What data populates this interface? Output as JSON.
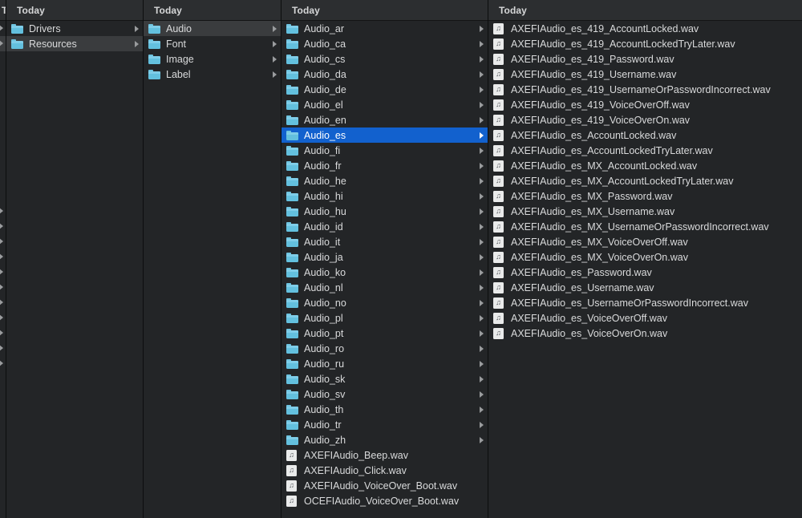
{
  "window": {
    "view_mode": "column",
    "background_color": "#232527",
    "selection_color": "#1261ce",
    "header_label": "Today"
  },
  "columns": [
    {
      "id": "partial-left",
      "header": "Today",
      "truncated": true,
      "stub_rows": [
        {
          "arrow": true,
          "highlighted": false
        },
        {
          "arrow": true,
          "highlighted": true
        },
        {
          "arrow": false,
          "highlighted": false
        },
        {
          "arrow": false,
          "highlighted": false
        },
        {
          "arrow": false,
          "highlighted": false
        },
        {
          "arrow": false,
          "highlighted": false
        },
        {
          "arrow": false,
          "highlighted": false
        },
        {
          "arrow": false,
          "highlighted": false
        },
        {
          "arrow": false,
          "highlighted": false
        },
        {
          "arrow": false,
          "highlighted": false
        },
        {
          "arrow": false,
          "highlighted": false
        },
        {
          "arrow": false,
          "highlighted": false
        },
        {
          "arrow": true,
          "highlighted": false
        },
        {
          "arrow": true,
          "highlighted": false
        },
        {
          "arrow": true,
          "highlighted": false
        },
        {
          "arrow": true,
          "highlighted": false
        },
        {
          "arrow": true,
          "highlighted": false
        },
        {
          "arrow": true,
          "highlighted": false
        },
        {
          "arrow": true,
          "highlighted": false
        },
        {
          "arrow": true,
          "highlighted": false
        },
        {
          "arrow": true,
          "highlighted": false
        },
        {
          "arrow": true,
          "highlighted": false
        },
        {
          "arrow": true,
          "highlighted": false
        }
      ]
    },
    {
      "id": "col-drivers",
      "header": "Today",
      "items": [
        {
          "name": "Drivers",
          "icon": "folder-icon",
          "arrow": true,
          "selected": false,
          "hovered": false
        },
        {
          "name": "Resources",
          "icon": "folder-icon",
          "arrow": true,
          "selected": false,
          "hovered": true
        }
      ]
    },
    {
      "id": "col-resources",
      "header": "Today",
      "items": [
        {
          "name": "Audio",
          "icon": "folder-icon",
          "arrow": true,
          "selected": false,
          "hovered": true
        },
        {
          "name": "Font",
          "icon": "folder-icon",
          "arrow": true,
          "selected": false,
          "hovered": false
        },
        {
          "name": "Image",
          "icon": "folder-icon",
          "arrow": true,
          "selected": false,
          "hovered": false
        },
        {
          "name": "Label",
          "icon": "folder-icon",
          "arrow": true,
          "selected": false,
          "hovered": false
        }
      ]
    },
    {
      "id": "col-audio",
      "header": "Today",
      "items": [
        {
          "name": "Audio_ar",
          "icon": "folder-icon",
          "arrow": true,
          "selected": false,
          "hovered": false
        },
        {
          "name": "Audio_ca",
          "icon": "folder-icon",
          "arrow": true,
          "selected": false,
          "hovered": false
        },
        {
          "name": "Audio_cs",
          "icon": "folder-icon",
          "arrow": true,
          "selected": false,
          "hovered": false
        },
        {
          "name": "Audio_da",
          "icon": "folder-icon",
          "arrow": true,
          "selected": false,
          "hovered": false
        },
        {
          "name": "Audio_de",
          "icon": "folder-icon",
          "arrow": true,
          "selected": false,
          "hovered": false
        },
        {
          "name": "Audio_el",
          "icon": "folder-icon",
          "arrow": true,
          "selected": false,
          "hovered": false
        },
        {
          "name": "Audio_en",
          "icon": "folder-icon",
          "arrow": true,
          "selected": false,
          "hovered": false
        },
        {
          "name": "Audio_es",
          "icon": "folder-icon",
          "arrow": true,
          "selected": true,
          "hovered": false
        },
        {
          "name": "Audio_fi",
          "icon": "folder-icon",
          "arrow": true,
          "selected": false,
          "hovered": false
        },
        {
          "name": "Audio_fr",
          "icon": "folder-icon",
          "arrow": true,
          "selected": false,
          "hovered": false
        },
        {
          "name": "Audio_he",
          "icon": "folder-icon",
          "arrow": true,
          "selected": false,
          "hovered": false
        },
        {
          "name": "Audio_hi",
          "icon": "folder-icon",
          "arrow": true,
          "selected": false,
          "hovered": false
        },
        {
          "name": "Audio_hu",
          "icon": "folder-icon",
          "arrow": true,
          "selected": false,
          "hovered": false
        },
        {
          "name": "Audio_id",
          "icon": "folder-icon",
          "arrow": true,
          "selected": false,
          "hovered": false
        },
        {
          "name": "Audio_it",
          "icon": "folder-icon",
          "arrow": true,
          "selected": false,
          "hovered": false
        },
        {
          "name": "Audio_ja",
          "icon": "folder-icon",
          "arrow": true,
          "selected": false,
          "hovered": false
        },
        {
          "name": "Audio_ko",
          "icon": "folder-icon",
          "arrow": true,
          "selected": false,
          "hovered": false
        },
        {
          "name": "Audio_nl",
          "icon": "folder-icon",
          "arrow": true,
          "selected": false,
          "hovered": false
        },
        {
          "name": "Audio_no",
          "icon": "folder-icon",
          "arrow": true,
          "selected": false,
          "hovered": false
        },
        {
          "name": "Audio_pl",
          "icon": "folder-icon",
          "arrow": true,
          "selected": false,
          "hovered": false
        },
        {
          "name": "Audio_pt",
          "icon": "folder-icon",
          "arrow": true,
          "selected": false,
          "hovered": false
        },
        {
          "name": "Audio_ro",
          "icon": "folder-icon",
          "arrow": true,
          "selected": false,
          "hovered": false
        },
        {
          "name": "Audio_ru",
          "icon": "folder-icon",
          "arrow": true,
          "selected": false,
          "hovered": false
        },
        {
          "name": "Audio_sk",
          "icon": "folder-icon",
          "arrow": true,
          "selected": false,
          "hovered": false
        },
        {
          "name": "Audio_sv",
          "icon": "folder-icon",
          "arrow": true,
          "selected": false,
          "hovered": false
        },
        {
          "name": "Audio_th",
          "icon": "folder-icon",
          "arrow": true,
          "selected": false,
          "hovered": false
        },
        {
          "name": "Audio_tr",
          "icon": "folder-icon",
          "arrow": true,
          "selected": false,
          "hovered": false
        },
        {
          "name": "Audio_zh",
          "icon": "folder-icon",
          "arrow": true,
          "selected": false,
          "hovered": false
        },
        {
          "name": "AXEFIAudio_Beep.wav",
          "icon": "audio-file-icon",
          "arrow": false,
          "selected": false,
          "hovered": false
        },
        {
          "name": "AXEFIAudio_Click.wav",
          "icon": "audio-file-icon",
          "arrow": false,
          "selected": false,
          "hovered": false
        },
        {
          "name": "AXEFIAudio_VoiceOver_Boot.wav",
          "icon": "audio-file-icon",
          "arrow": false,
          "selected": false,
          "hovered": false
        },
        {
          "name": "OCEFIAudio_VoiceOver_Boot.wav",
          "icon": "audio-file-icon",
          "arrow": false,
          "selected": false,
          "hovered": false
        }
      ]
    },
    {
      "id": "col-files",
      "header": "Today",
      "items": [
        {
          "name": "AXEFIAudio_es_419_AccountLocked.wav",
          "icon": "audio-file-icon",
          "arrow": false,
          "selected": false,
          "hovered": false
        },
        {
          "name": "AXEFIAudio_es_419_AccountLockedTryLater.wav",
          "icon": "audio-file-icon",
          "arrow": false,
          "selected": false,
          "hovered": false
        },
        {
          "name": "AXEFIAudio_es_419_Password.wav",
          "icon": "audio-file-icon",
          "arrow": false,
          "selected": false,
          "hovered": false
        },
        {
          "name": "AXEFIAudio_es_419_Username.wav",
          "icon": "audio-file-icon",
          "arrow": false,
          "selected": false,
          "hovered": false
        },
        {
          "name": "AXEFIAudio_es_419_UsernameOrPasswordIncorrect.wav",
          "icon": "audio-file-icon",
          "arrow": false,
          "selected": false,
          "hovered": false
        },
        {
          "name": "AXEFIAudio_es_419_VoiceOverOff.wav",
          "icon": "audio-file-icon",
          "arrow": false,
          "selected": false,
          "hovered": false
        },
        {
          "name": "AXEFIAudio_es_419_VoiceOverOn.wav",
          "icon": "audio-file-icon",
          "arrow": false,
          "selected": false,
          "hovered": false
        },
        {
          "name": "AXEFIAudio_es_AccountLocked.wav",
          "icon": "audio-file-icon",
          "arrow": false,
          "selected": false,
          "hovered": false
        },
        {
          "name": "AXEFIAudio_es_AccountLockedTryLater.wav",
          "icon": "audio-file-icon",
          "arrow": false,
          "selected": false,
          "hovered": false
        },
        {
          "name": "AXEFIAudio_es_MX_AccountLocked.wav",
          "icon": "audio-file-icon",
          "arrow": false,
          "selected": false,
          "hovered": false
        },
        {
          "name": "AXEFIAudio_es_MX_AccountLockedTryLater.wav",
          "icon": "audio-file-icon",
          "arrow": false,
          "selected": false,
          "hovered": false
        },
        {
          "name": "AXEFIAudio_es_MX_Password.wav",
          "icon": "audio-file-icon",
          "arrow": false,
          "selected": false,
          "hovered": false
        },
        {
          "name": "AXEFIAudio_es_MX_Username.wav",
          "icon": "audio-file-icon",
          "arrow": false,
          "selected": false,
          "hovered": false
        },
        {
          "name": "AXEFIAudio_es_MX_UsernameOrPasswordIncorrect.wav",
          "icon": "audio-file-icon",
          "arrow": false,
          "selected": false,
          "hovered": false
        },
        {
          "name": "AXEFIAudio_es_MX_VoiceOverOff.wav",
          "icon": "audio-file-icon",
          "arrow": false,
          "selected": false,
          "hovered": false
        },
        {
          "name": "AXEFIAudio_es_MX_VoiceOverOn.wav",
          "icon": "audio-file-icon",
          "arrow": false,
          "selected": false,
          "hovered": false
        },
        {
          "name": "AXEFIAudio_es_Password.wav",
          "icon": "audio-file-icon",
          "arrow": false,
          "selected": false,
          "hovered": false
        },
        {
          "name": "AXEFIAudio_es_Username.wav",
          "icon": "audio-file-icon",
          "arrow": false,
          "selected": false,
          "hovered": false
        },
        {
          "name": "AXEFIAudio_es_UsernameOrPasswordIncorrect.wav",
          "icon": "audio-file-icon",
          "arrow": false,
          "selected": false,
          "hovered": false
        },
        {
          "name": "AXEFIAudio_es_VoiceOverOff.wav",
          "icon": "audio-file-icon",
          "arrow": false,
          "selected": false,
          "hovered": false
        },
        {
          "name": "AXEFIAudio_es_VoiceOverOn.wav",
          "icon": "audio-file-icon",
          "arrow": false,
          "selected": false,
          "hovered": false
        }
      ]
    }
  ]
}
